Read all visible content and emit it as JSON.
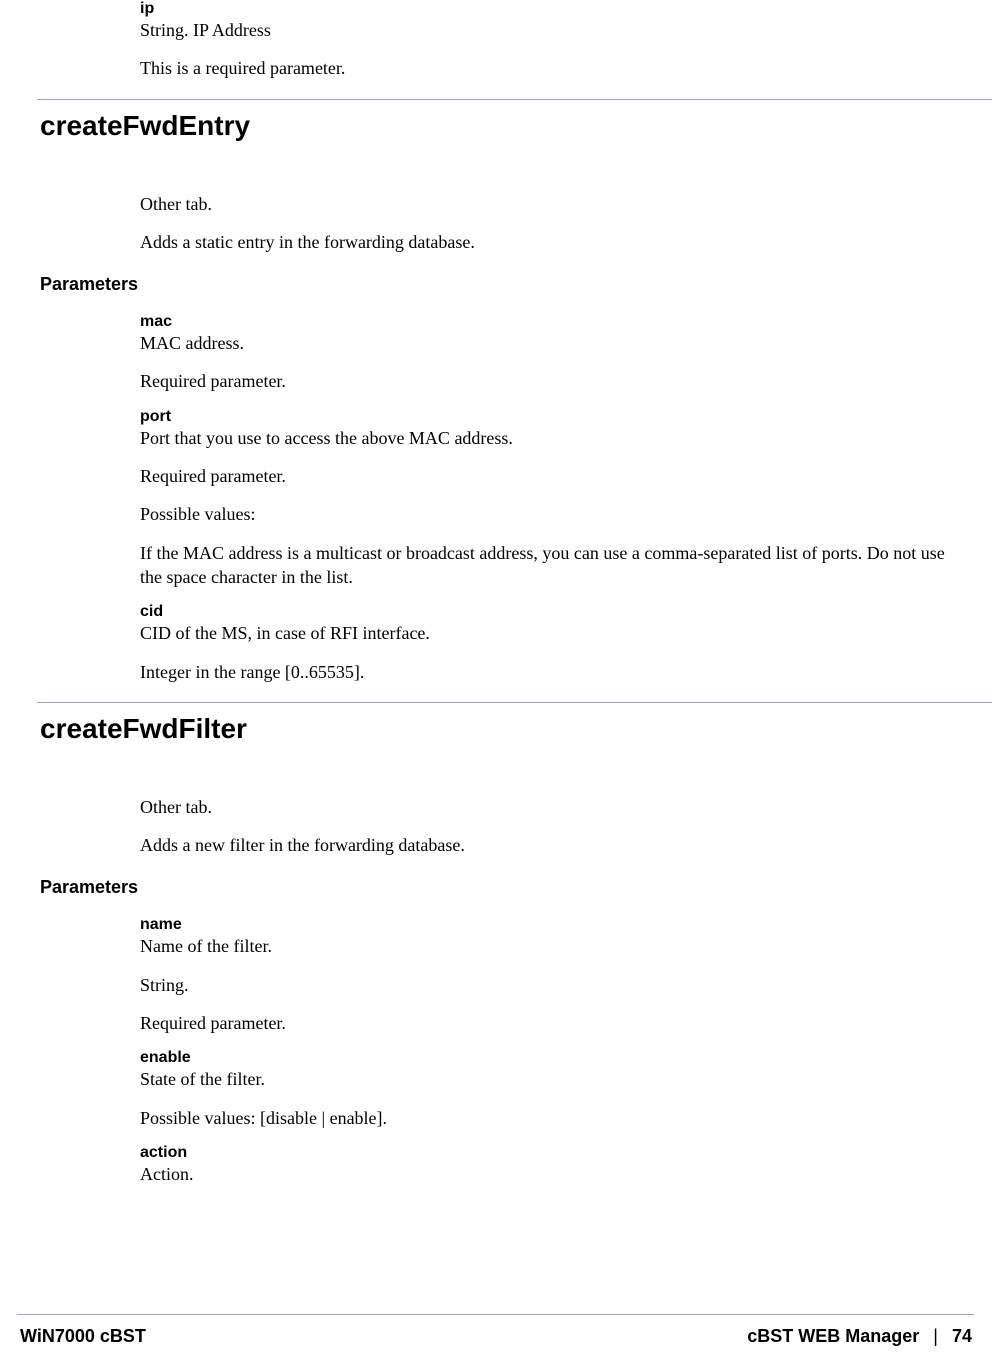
{
  "ip_block": {
    "name": "ip",
    "desc": "String. IP Address",
    "note": "This is a required parameter."
  },
  "sec1": {
    "heading": "createFwdEntry",
    "intro1": "Other tab.",
    "intro2": "Adds a static entry in the forwarding database.",
    "params_label": "Parameters",
    "mac": {
      "name": "mac",
      "desc": "MAC address.",
      "req": "Required parameter."
    },
    "port": {
      "name": "port",
      "desc": "Port that you use to access the above MAC address.",
      "req": "Required parameter.",
      "pv": "Possible values:",
      "note": "If the MAC address is a multicast or broadcast address, you can use a comma-separated list of ports. Do not use the space character in the list."
    },
    "cid": {
      "name": "cid",
      "desc": "CID of the MS, in case of RFI interface.",
      "range": "Integer in the range [0..65535]."
    }
  },
  "sec2": {
    "heading": "createFwdFilter",
    "intro1": "Other tab.",
    "intro2": "Adds a new filter in the forwarding database.",
    "params_label": "Parameters",
    "namep": {
      "name": "name",
      "desc": "Name of the filter.",
      "type": "String.",
      "req": "Required parameter."
    },
    "enable": {
      "name": "enable",
      "desc": "State of the filter.",
      "pv": "Possible values: [disable | enable]."
    },
    "action": {
      "name": "action",
      "desc": "Action."
    }
  },
  "footer": {
    "left": "WiN7000 cBST",
    "right_title": "cBST WEB Manager",
    "sep": "|",
    "page": "74"
  }
}
